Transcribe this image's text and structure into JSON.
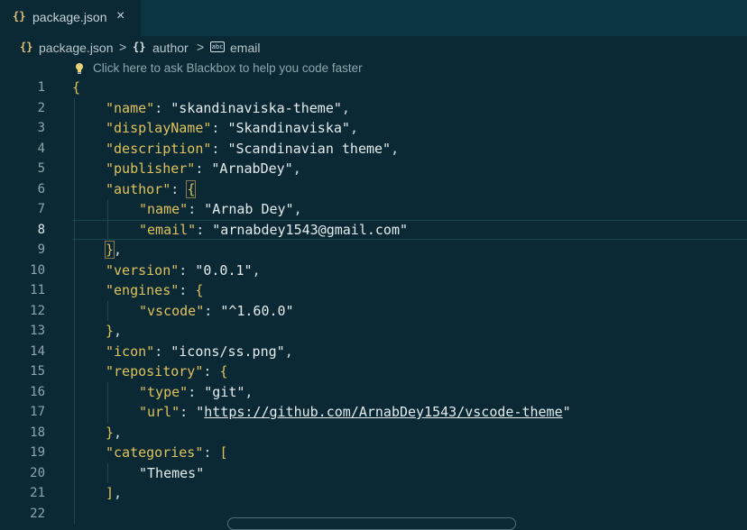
{
  "tab": {
    "icon": "braces-icon",
    "title": "package.json",
    "close": "×"
  },
  "breadcrumb": {
    "items": [
      {
        "icon": "json-braces-icon",
        "label": "package.json"
      },
      {
        "icon": "object-braces-icon",
        "label": "author"
      },
      {
        "icon": "string-icon",
        "label": "email"
      }
    ],
    "separator": ">"
  },
  "hint": {
    "icon": "lightbulb-icon",
    "text": "Click here to ask Blackbox to help you code faster"
  },
  "editor": {
    "active_line": 8,
    "lines": [
      {
        "n": "1",
        "tokens": [
          [
            "b",
            "{"
          ]
        ],
        "indent": 0
      },
      {
        "n": "2",
        "tokens": [
          [
            "k",
            "\"name\""
          ],
          [
            "p",
            ": "
          ],
          [
            "s",
            "\"skandinaviska-theme\""
          ],
          [
            "p",
            ","
          ]
        ],
        "indent": 1
      },
      {
        "n": "3",
        "tokens": [
          [
            "k",
            "\"displayName\""
          ],
          [
            "p",
            ": "
          ],
          [
            "s",
            "\"Skandinaviska\""
          ],
          [
            "p",
            ","
          ]
        ],
        "indent": 1
      },
      {
        "n": "4",
        "tokens": [
          [
            "k",
            "\"description\""
          ],
          [
            "p",
            ": "
          ],
          [
            "s",
            "\"Scandinavian theme\""
          ],
          [
            "p",
            ","
          ]
        ],
        "indent": 1
      },
      {
        "n": "5",
        "tokens": [
          [
            "k",
            "\"publisher\""
          ],
          [
            "p",
            ": "
          ],
          [
            "s",
            "\"ArnabDey\""
          ],
          [
            "p",
            ","
          ]
        ],
        "indent": 1
      },
      {
        "n": "6",
        "tokens": [
          [
            "k",
            "\"author\""
          ],
          [
            "p",
            ": "
          ],
          [
            "bx",
            "{"
          ]
        ],
        "indent": 1
      },
      {
        "n": "7",
        "tokens": [
          [
            "k",
            "\"name\""
          ],
          [
            "p",
            ": "
          ],
          [
            "s",
            "\"Arnab Dey\""
          ],
          [
            "p",
            ","
          ]
        ],
        "indent": 2
      },
      {
        "n": "8",
        "tokens": [
          [
            "k",
            "\"email\""
          ],
          [
            "p",
            ": "
          ],
          [
            "s",
            "\"arnabdey1543@gmail.com\""
          ]
        ],
        "indent": 2
      },
      {
        "n": "9",
        "tokens": [
          [
            "bx",
            "}"
          ],
          [
            "p",
            ","
          ]
        ],
        "indent": 1
      },
      {
        "n": "10",
        "tokens": [
          [
            "k",
            "\"version\""
          ],
          [
            "p",
            ": "
          ],
          [
            "s",
            "\"0.0.1\""
          ],
          [
            "p",
            ","
          ]
        ],
        "indent": 1
      },
      {
        "n": "11",
        "tokens": [
          [
            "k",
            "\"engines\""
          ],
          [
            "p",
            ": "
          ],
          [
            "b",
            "{"
          ]
        ],
        "indent": 1
      },
      {
        "n": "12",
        "tokens": [
          [
            "k",
            "\"vscode\""
          ],
          [
            "p",
            ": "
          ],
          [
            "s",
            "\"^1.60.0\""
          ]
        ],
        "indent": 2
      },
      {
        "n": "13",
        "tokens": [
          [
            "b",
            "}"
          ],
          [
            "p",
            ","
          ]
        ],
        "indent": 1
      },
      {
        "n": "14",
        "tokens": [
          [
            "k",
            "\"icon\""
          ],
          [
            "p",
            ": "
          ],
          [
            "s",
            "\"icons/ss.png\""
          ],
          [
            "p",
            ","
          ]
        ],
        "indent": 1
      },
      {
        "n": "15",
        "tokens": [
          [
            "k",
            "\"repository\""
          ],
          [
            "p",
            ": "
          ],
          [
            "b",
            "{"
          ]
        ],
        "indent": 1
      },
      {
        "n": "16",
        "tokens": [
          [
            "k",
            "\"type\""
          ],
          [
            "p",
            ": "
          ],
          [
            "s",
            "\"git\""
          ],
          [
            "p",
            ","
          ]
        ],
        "indent": 2
      },
      {
        "n": "17",
        "tokens": [
          [
            "k",
            "\"url\""
          ],
          [
            "p",
            ": "
          ],
          [
            "s",
            "\""
          ],
          [
            "u",
            "https://github.com/ArnabDey1543/vscode-theme"
          ],
          [
            "s",
            "\""
          ]
        ],
        "indent": 2
      },
      {
        "n": "18",
        "tokens": [
          [
            "b",
            "}"
          ],
          [
            "p",
            ","
          ]
        ],
        "indent": 1
      },
      {
        "n": "19",
        "tokens": [
          [
            "k",
            "\"categories\""
          ],
          [
            "p",
            ": "
          ],
          [
            "b",
            "["
          ]
        ],
        "indent": 1
      },
      {
        "n": "20",
        "tokens": [
          [
            "s",
            "\"Themes\""
          ]
        ],
        "indent": 2
      },
      {
        "n": "21",
        "tokens": [
          [
            "b",
            "]"
          ],
          [
            "p",
            ","
          ]
        ],
        "indent": 1
      },
      {
        "n": "22",
        "tokens": [],
        "indent": 0
      }
    ]
  }
}
